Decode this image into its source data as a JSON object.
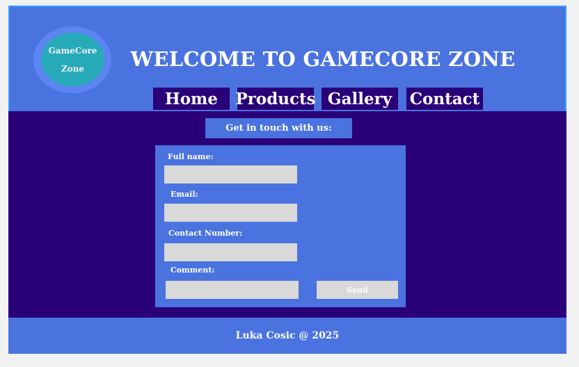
{
  "header": {
    "logo": {
      "line1": "GameCore",
      "line2": "Zone"
    },
    "title": "WELCOME TO GAMECORE ZONE",
    "nav": [
      {
        "label": "Home"
      },
      {
        "label": "Products"
      },
      {
        "label": "Gallery"
      },
      {
        "label": "Contact"
      }
    ]
  },
  "contact": {
    "heading": "Get in touch with us:",
    "fields": {
      "full_name": {
        "label": "Full name:",
        "value": ""
      },
      "email": {
        "label": "Email:",
        "value": ""
      },
      "contact_number": {
        "label": "Contact Number:",
        "value": ""
      },
      "comment": {
        "label": "Comment:",
        "value": ""
      }
    },
    "send_label": "Send"
  },
  "footer": {
    "text": "Luka Cosic @ 2025"
  },
  "colors": {
    "header_bg": "#4a73e0",
    "content_bg": "#2a0078",
    "logo_bg": "#26aab8",
    "input_bg": "#d9d9d9"
  }
}
